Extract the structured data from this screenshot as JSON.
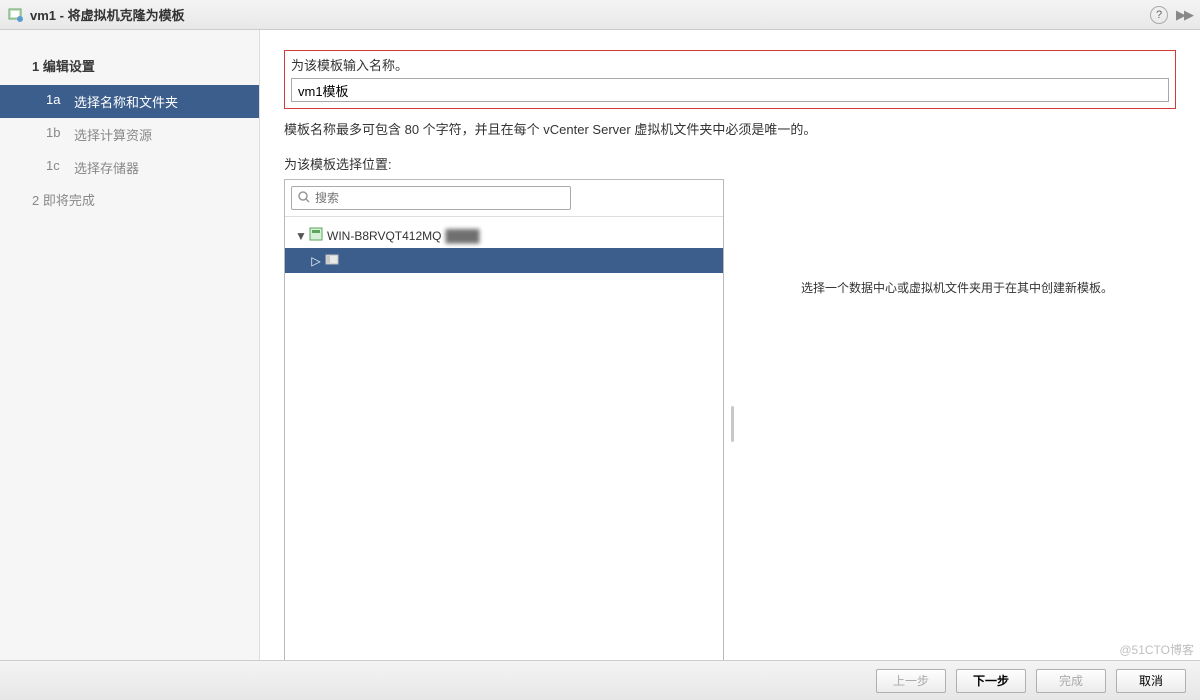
{
  "titlebar": {
    "title": "vm1 - 将虚拟机克隆为模板",
    "help_tooltip": "?"
  },
  "sidebar": {
    "step1_title": "1  编辑设置",
    "substeps": [
      {
        "key": "1a",
        "label": "选择名称和文件夹",
        "active": true
      },
      {
        "key": "1b",
        "label": "选择计算资源",
        "active": false
      },
      {
        "key": "1c",
        "label": "选择存储器",
        "active": false
      }
    ],
    "step2_title": "2  即将完成"
  },
  "main": {
    "name_label": "为该模板输入名称。",
    "name_value": "vm1模板",
    "name_hint": "模板名称最多可包含 80 个字符，并且在每个 vCenter Server 虚拟机文件夹中必须是唯一的。",
    "location_label": "为该模板选择位置:",
    "search_placeholder": "搜索",
    "tree": {
      "root": {
        "label": "WIN-B8RVQT412MQ",
        "expanded": true
      },
      "child": {
        "label": " ",
        "selected": true
      }
    },
    "right_hint": "选择一个数据中心或虚拟机文件夹用于在其中创建新模板。"
  },
  "footer": {
    "back": "上一步",
    "next": "下一步",
    "finish": "完成",
    "cancel": "取消"
  },
  "watermark": "@51CTO博客"
}
